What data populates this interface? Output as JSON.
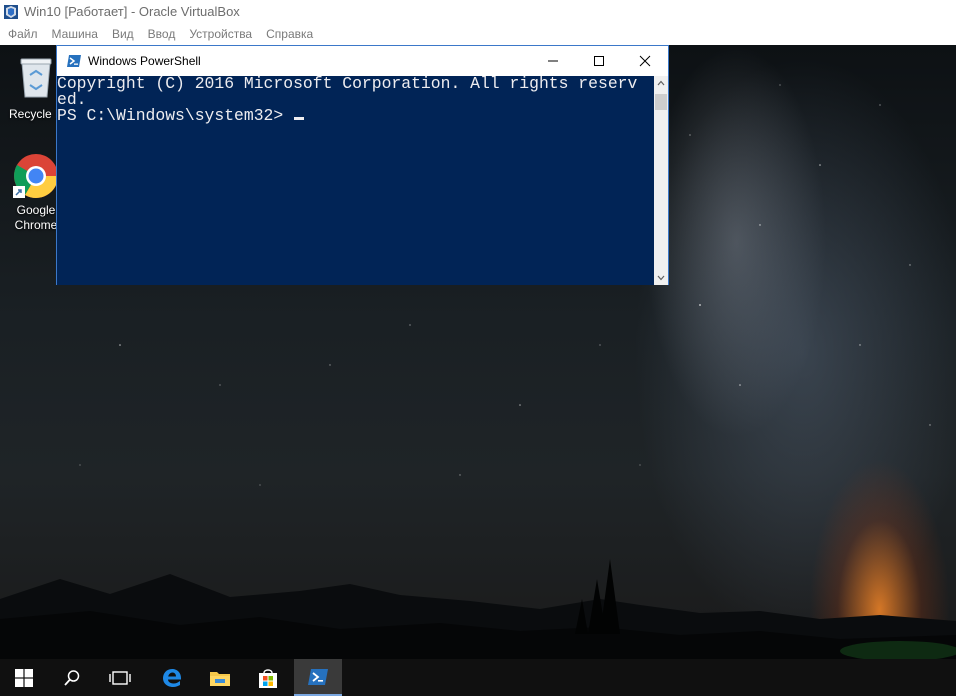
{
  "host": {
    "title": "Win10 [Работает] - Oracle VirtualBox",
    "menu": [
      "Файл",
      "Машина",
      "Вид",
      "Ввод",
      "Устройства",
      "Справка"
    ],
    "icon": "virtualbox-icon"
  },
  "desktop": {
    "icons": [
      {
        "label": "Recycle B",
        "icon": "recycle-bin-icon"
      },
      {
        "label_line1": "Google",
        "label_line2": "Chrome",
        "icon": "chrome-icon"
      }
    ]
  },
  "powershell": {
    "title": "Windows PowerShell",
    "lines": [
      "Copyright (C) 2016 Microsoft Corporation. All rights reserv",
      "ed.",
      "",
      "PS C:\\Windows\\system32> "
    ],
    "colors": {
      "console_bg": "#012456",
      "console_fg": "#eeedf0"
    }
  },
  "taskbar": {
    "items": [
      "start-icon",
      "search-icon",
      "task-view-icon",
      "edge-icon",
      "file-explorer-icon",
      "store-icon",
      "powershell-icon"
    ],
    "active": "powershell-icon"
  }
}
